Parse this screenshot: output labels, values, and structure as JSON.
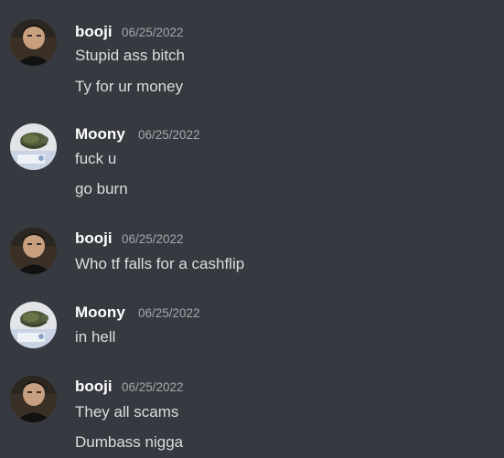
{
  "chat": {
    "messages": [
      {
        "author": "booji",
        "avatar_icon": "booji-avatar",
        "timestamp": "06/25/2022",
        "lines": [
          "Stupid ass bitch",
          "Ty for ur money"
        ]
      },
      {
        "author": "Moony",
        "avatar_icon": "moony-avatar",
        "timestamp": "06/25/2022",
        "lines": [
          "fuck u",
          "go burn"
        ]
      },
      {
        "author": "booji",
        "avatar_icon": "booji-avatar",
        "timestamp": "06/25/2022",
        "lines": [
          "Who tf falls for a cashflip"
        ]
      },
      {
        "author": "Moony",
        "avatar_icon": "moony-avatar",
        "timestamp": "06/25/2022",
        "lines": [
          "in hell"
        ]
      },
      {
        "author": "booji",
        "avatar_icon": "booji-avatar",
        "timestamp": "06/25/2022",
        "lines": [
          "They all scams",
          "Dumbass nigga"
        ]
      }
    ]
  },
  "colors": {
    "background": "#36393f",
    "username": "#ffffff",
    "timestamp": "#a3a6aa",
    "message_text": "#dcddde"
  }
}
